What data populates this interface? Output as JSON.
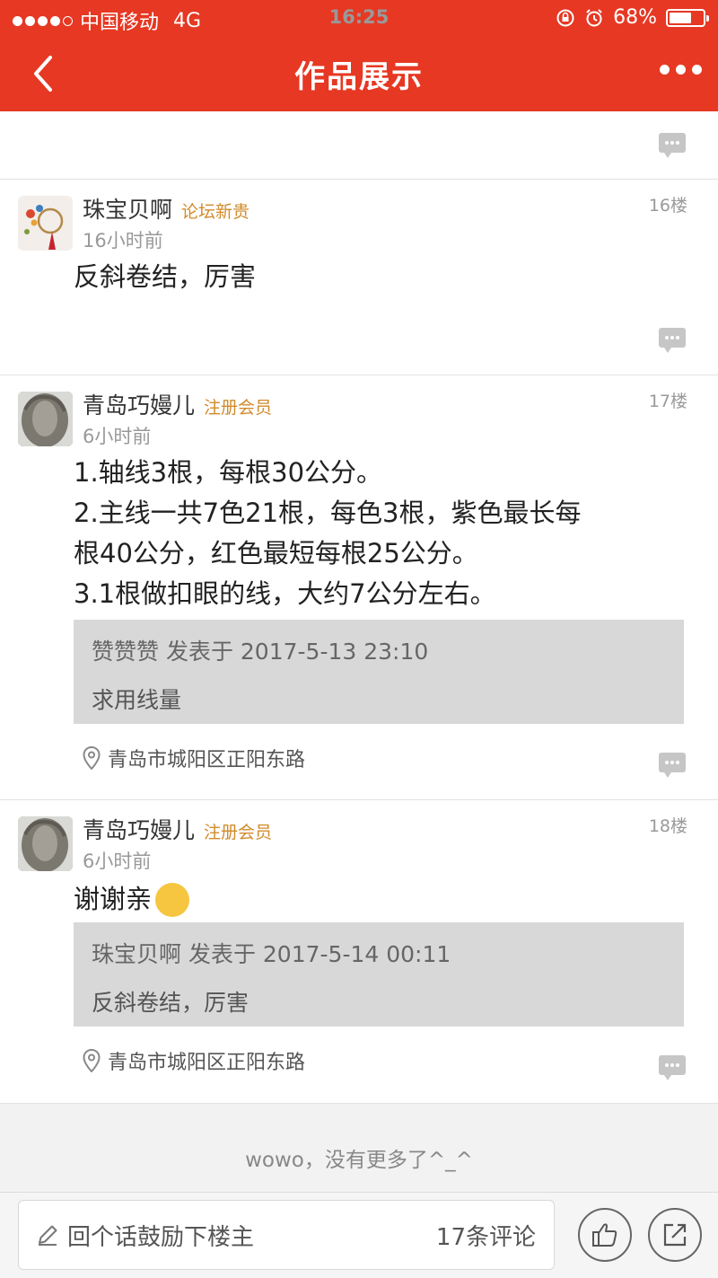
{
  "status_bar": {
    "carrier": "中国移动",
    "network": "4G",
    "time": "16:25",
    "battery": "68%",
    "battery_level": 0.68
  },
  "nav": {
    "title": "作品展示"
  },
  "posts": [
    {
      "user": "珠宝贝啊",
      "badge": "论坛新贵",
      "time": "16小时前",
      "floor": "16楼",
      "content": [
        "反斜卷结，厉害"
      ]
    },
    {
      "user": "青岛巧嫚儿",
      "badge": "注册会员",
      "time": "6小时前",
      "floor": "17楼",
      "content": [
        "1.轴线3根，每根30公分。",
        "2.主线一共7色21根，每色3根，紫色最长每",
        "根40公分，红色最短每根25公分。",
        "3.1根做扣眼的线，大约7公分左右。"
      ],
      "quote": {
        "header": "赞赞赞 发表于 2017-5-13 23:10",
        "body": "求用线量"
      },
      "location": "青岛市城阳区正阳东路"
    },
    {
      "user": "青岛巧嫚儿",
      "badge": "注册会员",
      "time": "6小时前",
      "floor": "18楼",
      "content": [
        "谢谢亲"
      ],
      "emoji": "😌",
      "quote": {
        "header": "珠宝贝啊 发表于 2017-5-14 00:11",
        "body": "反斜卷结，厉害"
      },
      "location": "青岛市城阳区正阳东路"
    }
  ],
  "footer": {
    "no_more": "wowo，没有更多了^_^"
  },
  "bottom_bar": {
    "reply_placeholder": "回个话鼓励下楼主",
    "comment_count": "17条评论"
  },
  "colors": {
    "brand": "#e63823",
    "badge": "#d18b2b",
    "quote_bg": "#d8d8d8"
  }
}
